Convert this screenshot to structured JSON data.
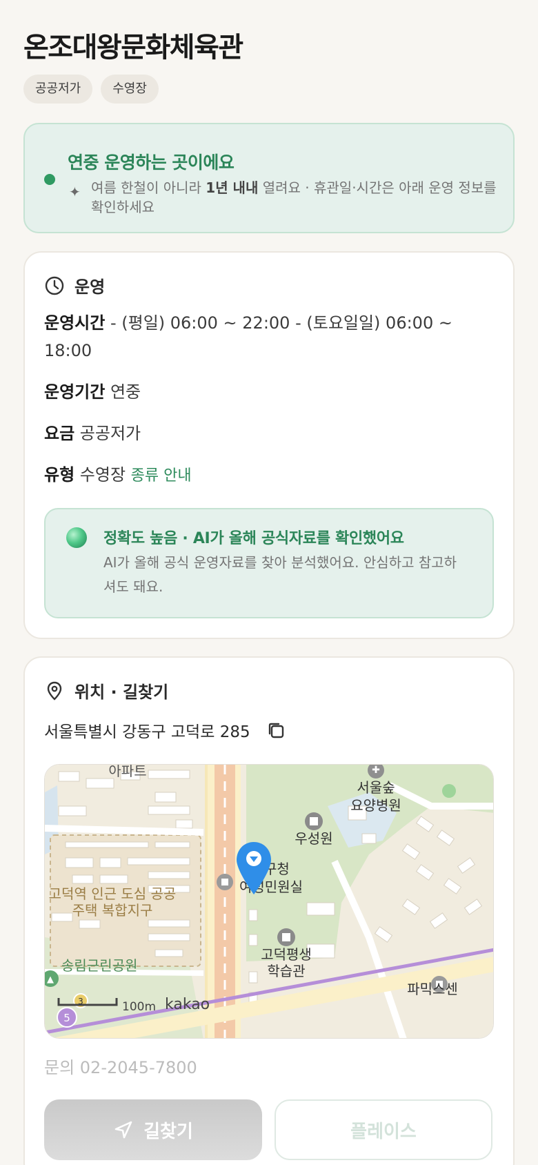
{
  "title": "온조대왕문화체육관",
  "tags": [
    "공공저가",
    "수영장"
  ],
  "season_notice": {
    "headline": "연중 운영하는 곳이에요",
    "desc_before": "여름 한철이 아니라 ",
    "desc_bold": "1년 내내",
    "desc_after": " 열려요 · 휴관일·시간은 아래 운영 정보를 확인하세요"
  },
  "operation": {
    "heading": "운영",
    "hours_label": "운영시간",
    "hours_value": " - (평일) 06:00 ~ 22:00 - (토요일일) 06:00 ~ 18:00",
    "period_label": "운영기간",
    "period_value": " 연중",
    "fee_label": "요금",
    "fee_value": " 공공저가",
    "type_label": "유형",
    "type_value": " 수영장 ",
    "type_link": "종류 안내",
    "ai": {
      "headline": "정확도 높음 · AI가 올해 공식자료를 확인했어요",
      "desc": "AI가 올해 공식 운영자료를 찾아 분석했어요. 안심하고 참고하셔도 돼요."
    }
  },
  "location": {
    "heading": "위치 · 길찾기",
    "address": "서울특별시 강동구 고덕로 285",
    "map_labels": {
      "apartment": "아파트",
      "hospital_line1": "서울숲",
      "hospital_line2": "요양병원",
      "woosung": "우성원",
      "office_line1": "강동구청",
      "office_line2": "여성민원실",
      "district_line1": "고덕역 인근 도심 공공",
      "district_line2": "주택 복합지구",
      "park": "송림근린공원",
      "library_line1": "고덕평생",
      "library_line2": "학습관",
      "store": "파믹스센",
      "scale": "100m",
      "brand": "kakao",
      "route3": "3",
      "route5": "5"
    },
    "phone": "문의 02-2045-7800",
    "route_button": "길찾기",
    "place_button": "플레이스"
  },
  "colors": {
    "accent_green": "#2b8558",
    "pin_blue": "#2f8ee8",
    "subway_purple": "#a77ed6"
  }
}
